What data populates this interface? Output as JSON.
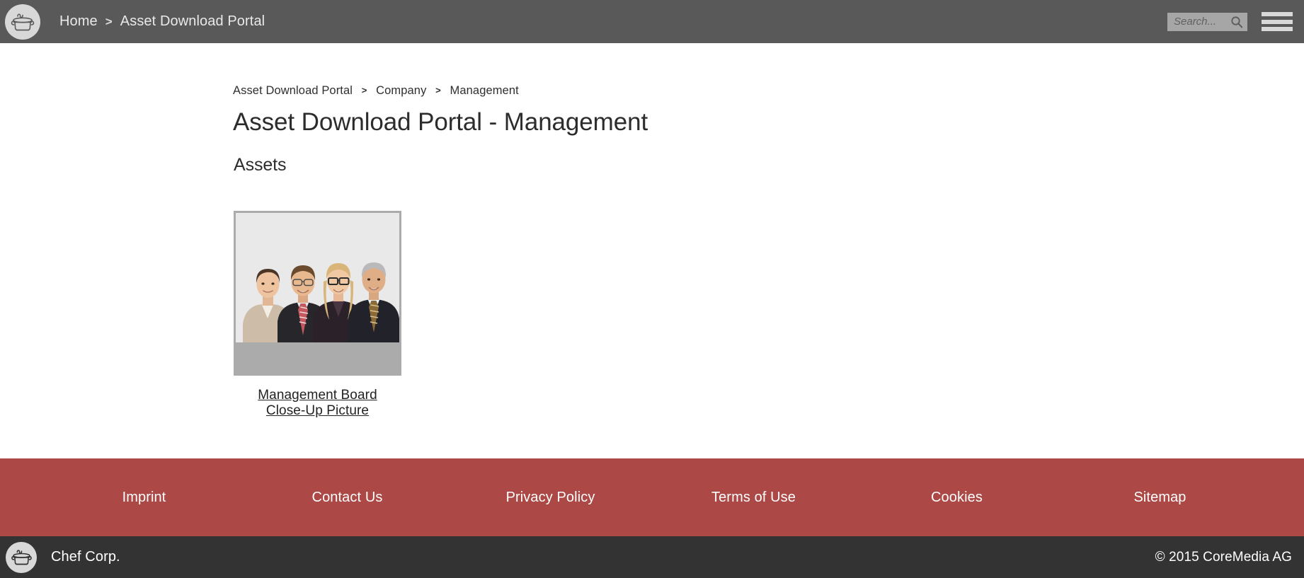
{
  "header": {
    "logo_icon": "cooking-pot-icon",
    "nav": [
      {
        "label": "Home"
      },
      {
        "label": "Asset Download Portal"
      }
    ],
    "nav_separator": ">",
    "search": {
      "placeholder": "Search...",
      "value": "",
      "icon": "search-icon"
    },
    "menu_icon": "hamburger-menu-icon",
    "background_color": "#595959"
  },
  "breadcrumb": {
    "separator": ">",
    "items": [
      {
        "label": "Asset Download Portal"
      },
      {
        "label": "Company"
      },
      {
        "label": "Management"
      }
    ]
  },
  "main": {
    "page_title": "Asset Download Portal - Management",
    "section_title": "Assets",
    "assets": [
      {
        "caption_line1": "Management Board",
        "caption_line2": "Close-Up Picture",
        "thumbnail_alt": "management-board-photo",
        "thumbnail_background": "#ababab"
      }
    ]
  },
  "footer": {
    "background_color": "#ac4845",
    "links": [
      {
        "label": "Imprint"
      },
      {
        "label": "Contact Us"
      },
      {
        "label": "Privacy Policy"
      },
      {
        "label": "Terms of Use"
      },
      {
        "label": "Cookies"
      },
      {
        "label": "Sitemap"
      }
    ]
  },
  "bottom_bar": {
    "background_color": "#333333",
    "logo_icon": "cooking-pot-icon",
    "brand": "Chef Corp.",
    "copyright": "© 2015 CoreMedia AG"
  }
}
